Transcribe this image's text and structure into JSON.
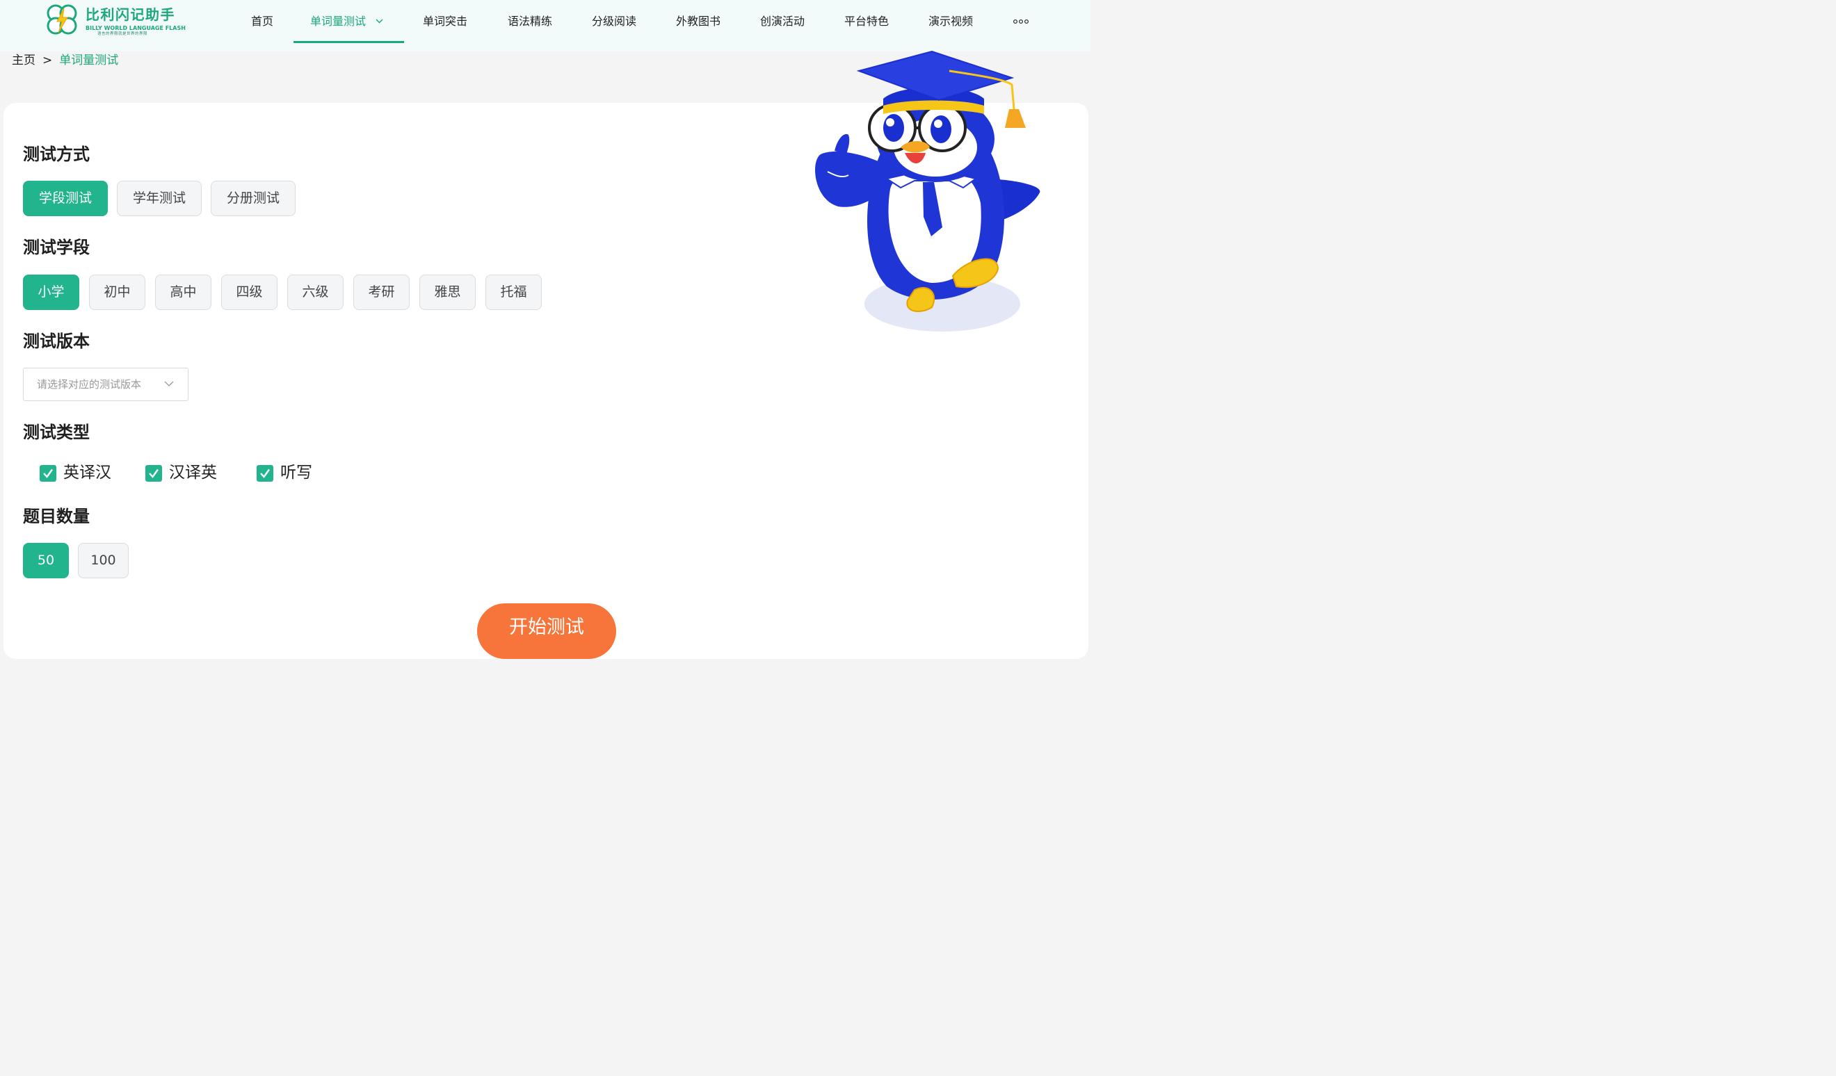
{
  "header": {
    "logo": {
      "title": "比利闪记助手",
      "subtitle_en": "BILLY WORLD LANGUAGE FLASH",
      "tagline": "语言的界限就是世界的界限"
    },
    "nav": [
      {
        "label": "首页"
      },
      {
        "label": "单词量测试",
        "active": true
      },
      {
        "label": "单词突击"
      },
      {
        "label": "语法精练"
      },
      {
        "label": "分级阅读"
      },
      {
        "label": "外教图书"
      },
      {
        "label": "创演活动"
      },
      {
        "label": "平台特色"
      },
      {
        "label": "演示视频"
      }
    ],
    "more_icon": "more-dots-icon"
  },
  "breadcrumb": {
    "home": "主页",
    "separator": ">",
    "current": "单词量测试"
  },
  "form": {
    "method": {
      "title": "测试方式",
      "options": [
        "学段测试",
        "学年测试",
        "分册测试"
      ],
      "selected": "学段测试"
    },
    "stage": {
      "title": "测试学段",
      "options": [
        "小学",
        "初中",
        "高中",
        "四级",
        "六级",
        "考研",
        "雅思",
        "托福"
      ],
      "selected": "小学"
    },
    "version": {
      "title": "测试版本",
      "placeholder": "请选择对应的测试版本"
    },
    "type": {
      "title": "测试类型",
      "options": [
        {
          "label": "英译汉",
          "checked": true
        },
        {
          "label": "汉译英",
          "checked": true
        },
        {
          "label": "听写",
          "checked": true
        }
      ]
    },
    "count": {
      "title": "题目数量",
      "options": [
        "50",
        "100"
      ],
      "selected": "50"
    },
    "start_label": "开始测试"
  },
  "colors": {
    "brand": "#1ca87b",
    "selected": "#21b48d",
    "start_button": "#f7743a"
  }
}
